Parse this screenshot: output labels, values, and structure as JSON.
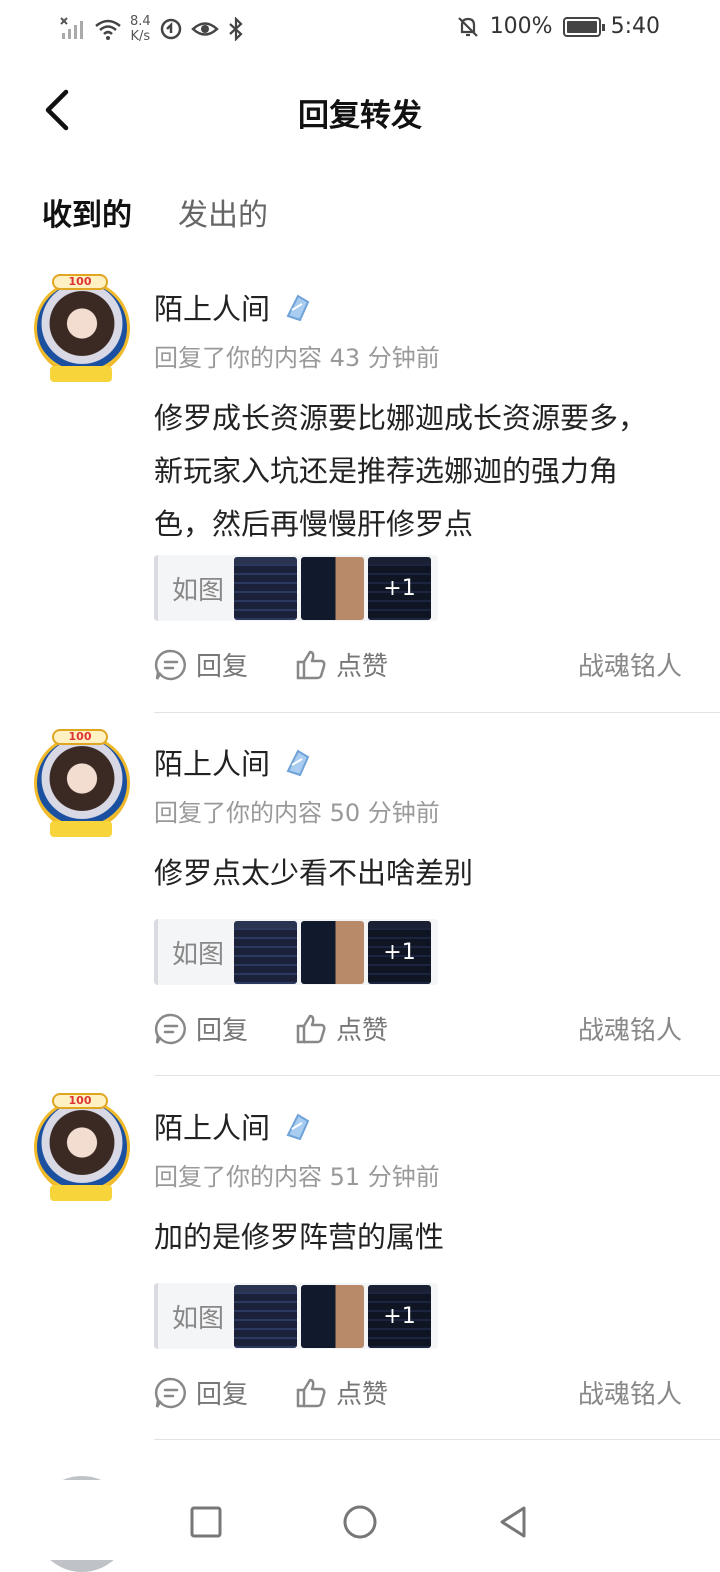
{
  "status_bar": {
    "speed_value": "8.4",
    "speed_unit": "K/s",
    "battery": "100%",
    "time": "5:40"
  },
  "header": {
    "title": "回复转发"
  },
  "tabs": [
    {
      "label": "收到的",
      "active": true
    },
    {
      "label": "发出的",
      "active": false
    }
  ],
  "items": [
    {
      "name": "陌上人间",
      "meta": "回复了你的内容 43 分钟前",
      "content": "修罗成长资源要比娜迦成长资源要多，新玩家入坑还是推荐选娜迦的强力角色，然后再慢慢肝修罗点",
      "quote_label": "如图",
      "more_images": "+1",
      "reply_label": "回复",
      "like_label": "点赞",
      "source": "战魂铭人"
    },
    {
      "name": "陌上人间",
      "meta": "回复了你的内容 50 分钟前",
      "content": "修罗点太少看不出啥差别",
      "quote_label": "如图",
      "more_images": "+1",
      "reply_label": "回复",
      "like_label": "点赞",
      "source": "战魂铭人"
    },
    {
      "name": "陌上人间",
      "meta": "回复了你的内容 51 分钟前",
      "content": "加的是修罗阵营的属性",
      "quote_label": "如图",
      "more_images": "+1",
      "reply_label": "回复",
      "like_label": "点赞",
      "source": "战魂铭人"
    }
  ],
  "avatar_badge": "100",
  "colors": {
    "accent": "#27d6c8",
    "muted_text": "#999999",
    "action_text": "#777777"
  }
}
